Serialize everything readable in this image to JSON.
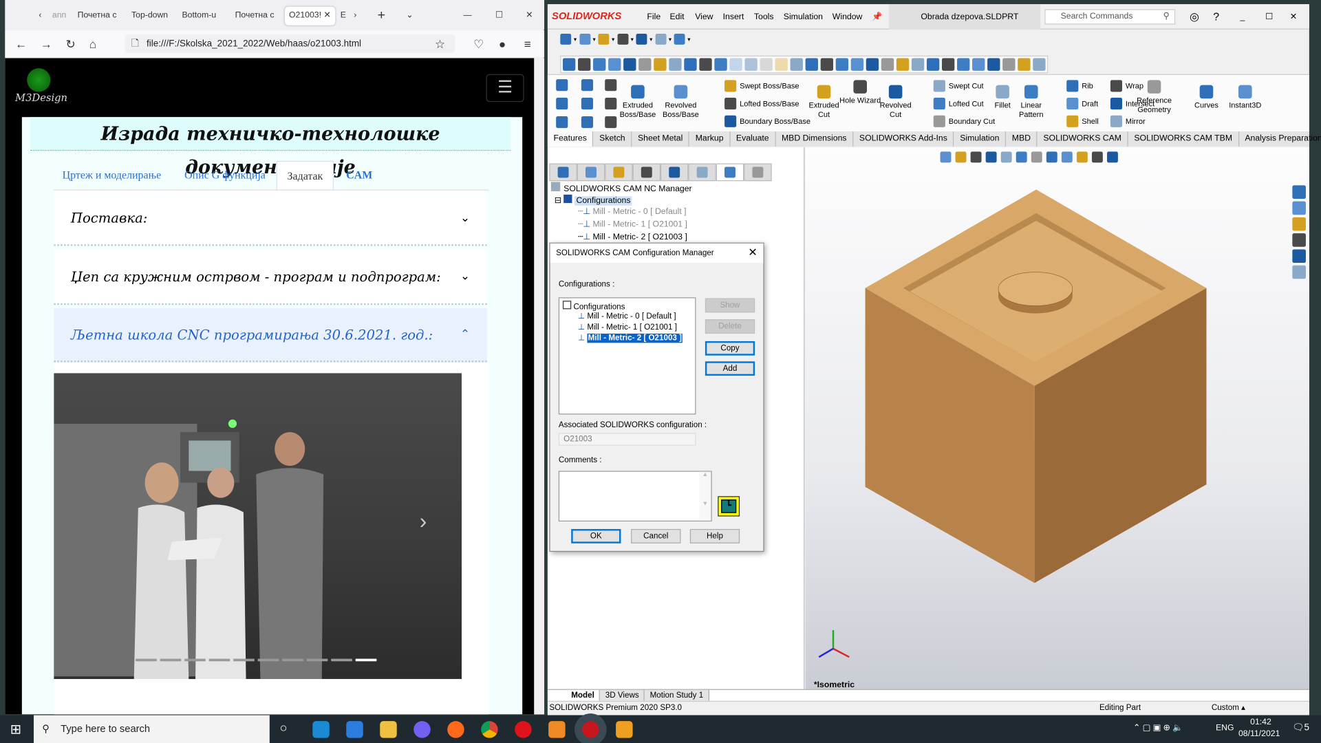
{
  "browser": {
    "tabs": [
      "ann",
      "Почетна с",
      "Top-down",
      "Bottom-u",
      "Почетна с",
      "O21003!",
      "Е"
    ],
    "active_tab": "O21003!",
    "url": "file:///F:/Skolska_2021_2022/Web/haas/o21003.html",
    "page": {
      "logo_text": "M3Design",
      "title": "Израда техничко-технолошке документације",
      "tabs": [
        "Цртеж и моделирање",
        "Опис G функција",
        "Задатак",
        "CAM"
      ],
      "active_tab": "Задатак",
      "accordion": [
        {
          "label": "Поставка:",
          "expanded": false
        },
        {
          "label": "Џеп са кружним острвом - програм и подпрограм:",
          "expanded": false
        },
        {
          "label": "Љетна школа CNC програмирања 30.6.2021. год.:",
          "expanded": true
        }
      ],
      "carousel": {
        "slides": 10,
        "active_slide": 10
      }
    }
  },
  "solidworks": {
    "brand": "SOLIDWORKS",
    "menu": [
      "File",
      "Edit",
      "View",
      "Insert",
      "Tools",
      "Simulation",
      "Window"
    ],
    "document_title": "Obrada dzepova.SLDPRT",
    "search_placeholder": "Search Commands",
    "ribbon": {
      "big": [
        "Extruded Boss/Base",
        "Revolved Boss/Base",
        "Extruded Cut",
        "Hole Wizard",
        "Revolved Cut",
        "Fillet",
        "Linear Pattern",
        "Reference Geometry",
        "Curves",
        "Instant3D"
      ],
      "small": [
        "Swept Boss/Base",
        "Lofted Boss/Base",
        "Boundary Boss/Base",
        "Swept Cut",
        "Lofted Cut",
        "Boundary Cut",
        "Rib",
        "Draft",
        "Shell",
        "Wrap",
        "Intersect",
        "Mirror"
      ]
    },
    "command_tabs": [
      "Features",
      "Sketch",
      "Sheet Metal",
      "Markup",
      "Evaluate",
      "MBD Dimensions",
      "SOLIDWORKS Add-Ins",
      "Simulation",
      "MBD",
      "SOLIDWORKS CAM",
      "SOLIDWORKS CAM TBM",
      "Analysis Preparation"
    ],
    "active_command_tab": "Features",
    "tree": {
      "root": "SOLIDWORKS CAM NC Manager",
      "configurations": "Configurations",
      "items": [
        "Mill - Metric - 0 [ Default ]",
        "Mill - Metric- 1 [ O21001 ]",
        "Mill - Metric- 2 [ O21003 ]"
      ]
    },
    "view_label": "*Isometric",
    "bottom_tabs": [
      "Model",
      "3D Views",
      "Motion Study 1"
    ],
    "active_bottom_tab": "Model",
    "status": {
      "version": "SOLIDWORKS Premium 2020 SP3.0",
      "mode": "Editing Part",
      "units": "Custom"
    },
    "dialog": {
      "title": "SOLIDWORKS CAM Configuration Manager",
      "configurations_label": "Configurations :",
      "list_root": "Configurations",
      "items": [
        "Mill - Metric - 0 [ Default ]",
        "Mill - Metric- 1 [ O21001 ]",
        "Mill - Metric- 2 [ O21003 ]"
      ],
      "selected": "Mill - Metric- 2 [ O21003 ]",
      "buttons": {
        "show": "Show",
        "delete": "Delete",
        "copy": "Copy",
        "add": "Add",
        "ok": "OK",
        "cancel": "Cancel",
        "help": "Help"
      },
      "assoc_label": "Associated SOLIDWORKS configuration :",
      "assoc_value": "O21003",
      "comments_label": "Comments :",
      "comments_value": ""
    }
  },
  "taskbar": {
    "search_placeholder": "Type here to search",
    "lang": "ENG",
    "time": "01:42",
    "date": "08/11/2021",
    "notifications": "5"
  },
  "colors": {
    "accent": "#0078d7",
    "selection": "#0a64c8",
    "sw_red": "#da291c",
    "wood": "#c8924f"
  }
}
